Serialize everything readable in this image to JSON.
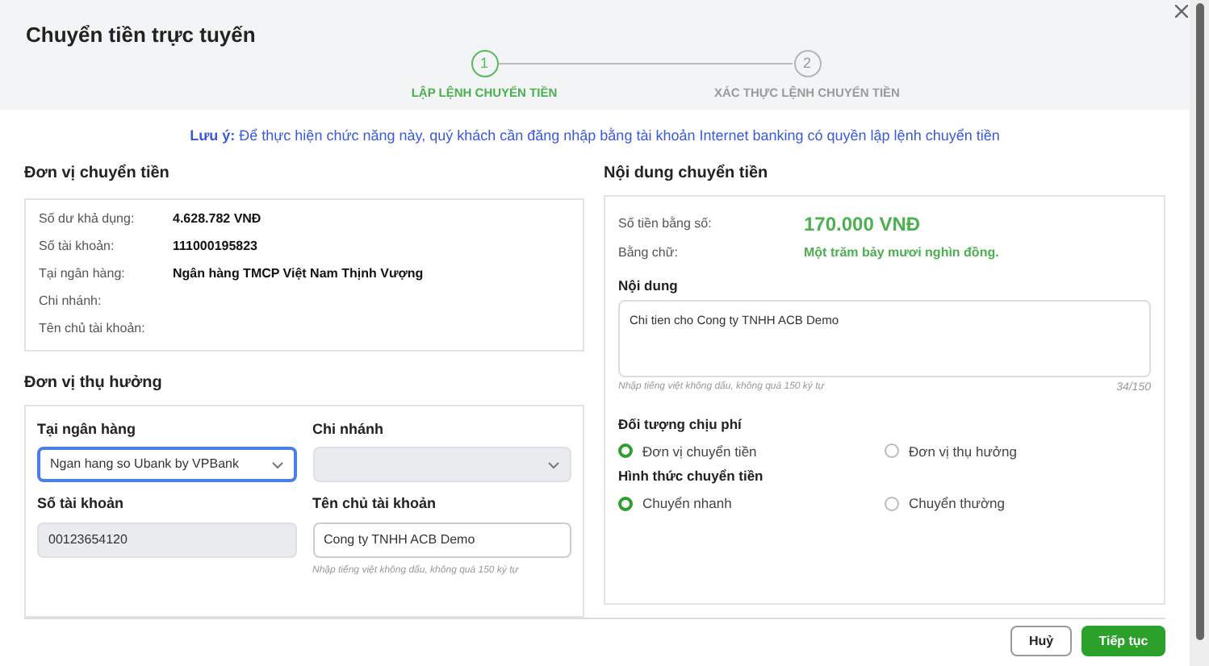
{
  "dialog": {
    "title": "Chuyển tiền trực tuyến"
  },
  "steps": [
    {
      "number": "1",
      "label": "LẬP LỆNH CHUYỂN TIỀN",
      "selected": true
    },
    {
      "number": "2",
      "label": "XÁC THỰC LỆNH CHUYỂN TIỀN",
      "selected": false
    }
  ],
  "notice": "**Lưu ý:** Để thực hiện chức năng này, quý khách cần đăng nhập bằng tài khoản Internet banking có quyền lập lệnh chuyển tiền",
  "sender": {
    "title": "Đơn vị chuyển tiền",
    "rows": [
      {
        "label": "Số dư khả dụng:",
        "value": "4.628.782 VNĐ"
      },
      {
        "label": "Số tài khoản:",
        "value": "111000195823"
      },
      {
        "label": "Tại ngân hàng:",
        "value": "Ngân hàng TMCP Việt Nam Thịnh Vượng"
      },
      {
        "label": "Chi nhánh:"
      },
      {
        "label": "Tên chủ tài khoản:"
      }
    ]
  },
  "beneficiary": {
    "title": "Đơn vị thụ hưởng",
    "fields": [
      {
        "kind": "select",
        "label": "Tại ngân hàng",
        "value": "Ngan hang so Ubank by VPBank",
        "disabled": false,
        "focused": true
      },
      {
        "kind": "select",
        "label": "Chi nhánh",
        "disabled": true,
        "focused": false
      },
      {
        "kind": "input",
        "label": "Số tài khoản",
        "value": "00123654120",
        "disabled": true,
        "focused": false
      },
      {
        "kind": "input",
        "label": "Tên chủ tài khoản",
        "value": "Cong ty TNHH ACB Demo",
        "disabled": false,
        "focused": false,
        "hint": "Nhập tiếng việt không dấu, không quá 150 ký tự"
      }
    ]
  },
  "content": {
    "title": "Nội dung chuyển tiền",
    "amount_label": "Số tiền bằng số:",
    "amount": "170.000 VNĐ",
    "words_label": "Bằng chữ:",
    "words": "Một trăm bảy mươi nghìn đồng.",
    "memo_label": "Nội dung",
    "memo": "Chi tien cho Cong ty TNHH ACB Demo",
    "memo_hint": "Nhập tiếng việt không dấu, không quá 150 ký tự",
    "memo_count": "34/150",
    "groups": [
      {
        "label": "Đối tượng chịu phí",
        "options": [
          {
            "label": "Đơn vị chuyển tiền",
            "selected": true
          },
          {
            "label": "Đơn vị thụ hưởng",
            "selected": false
          }
        ]
      },
      {
        "label": "Hình thức chuyển tiền",
        "options": [
          {
            "label": "Chuyển nhanh",
            "selected": true
          },
          {
            "label": "Chuyển thường",
            "selected": false
          }
        ]
      }
    ]
  },
  "buttons": [
    {
      "kind": "secondary",
      "label": "Huỷ"
    },
    {
      "kind": "primary",
      "label": "Tiếp tục"
    }
  ]
}
